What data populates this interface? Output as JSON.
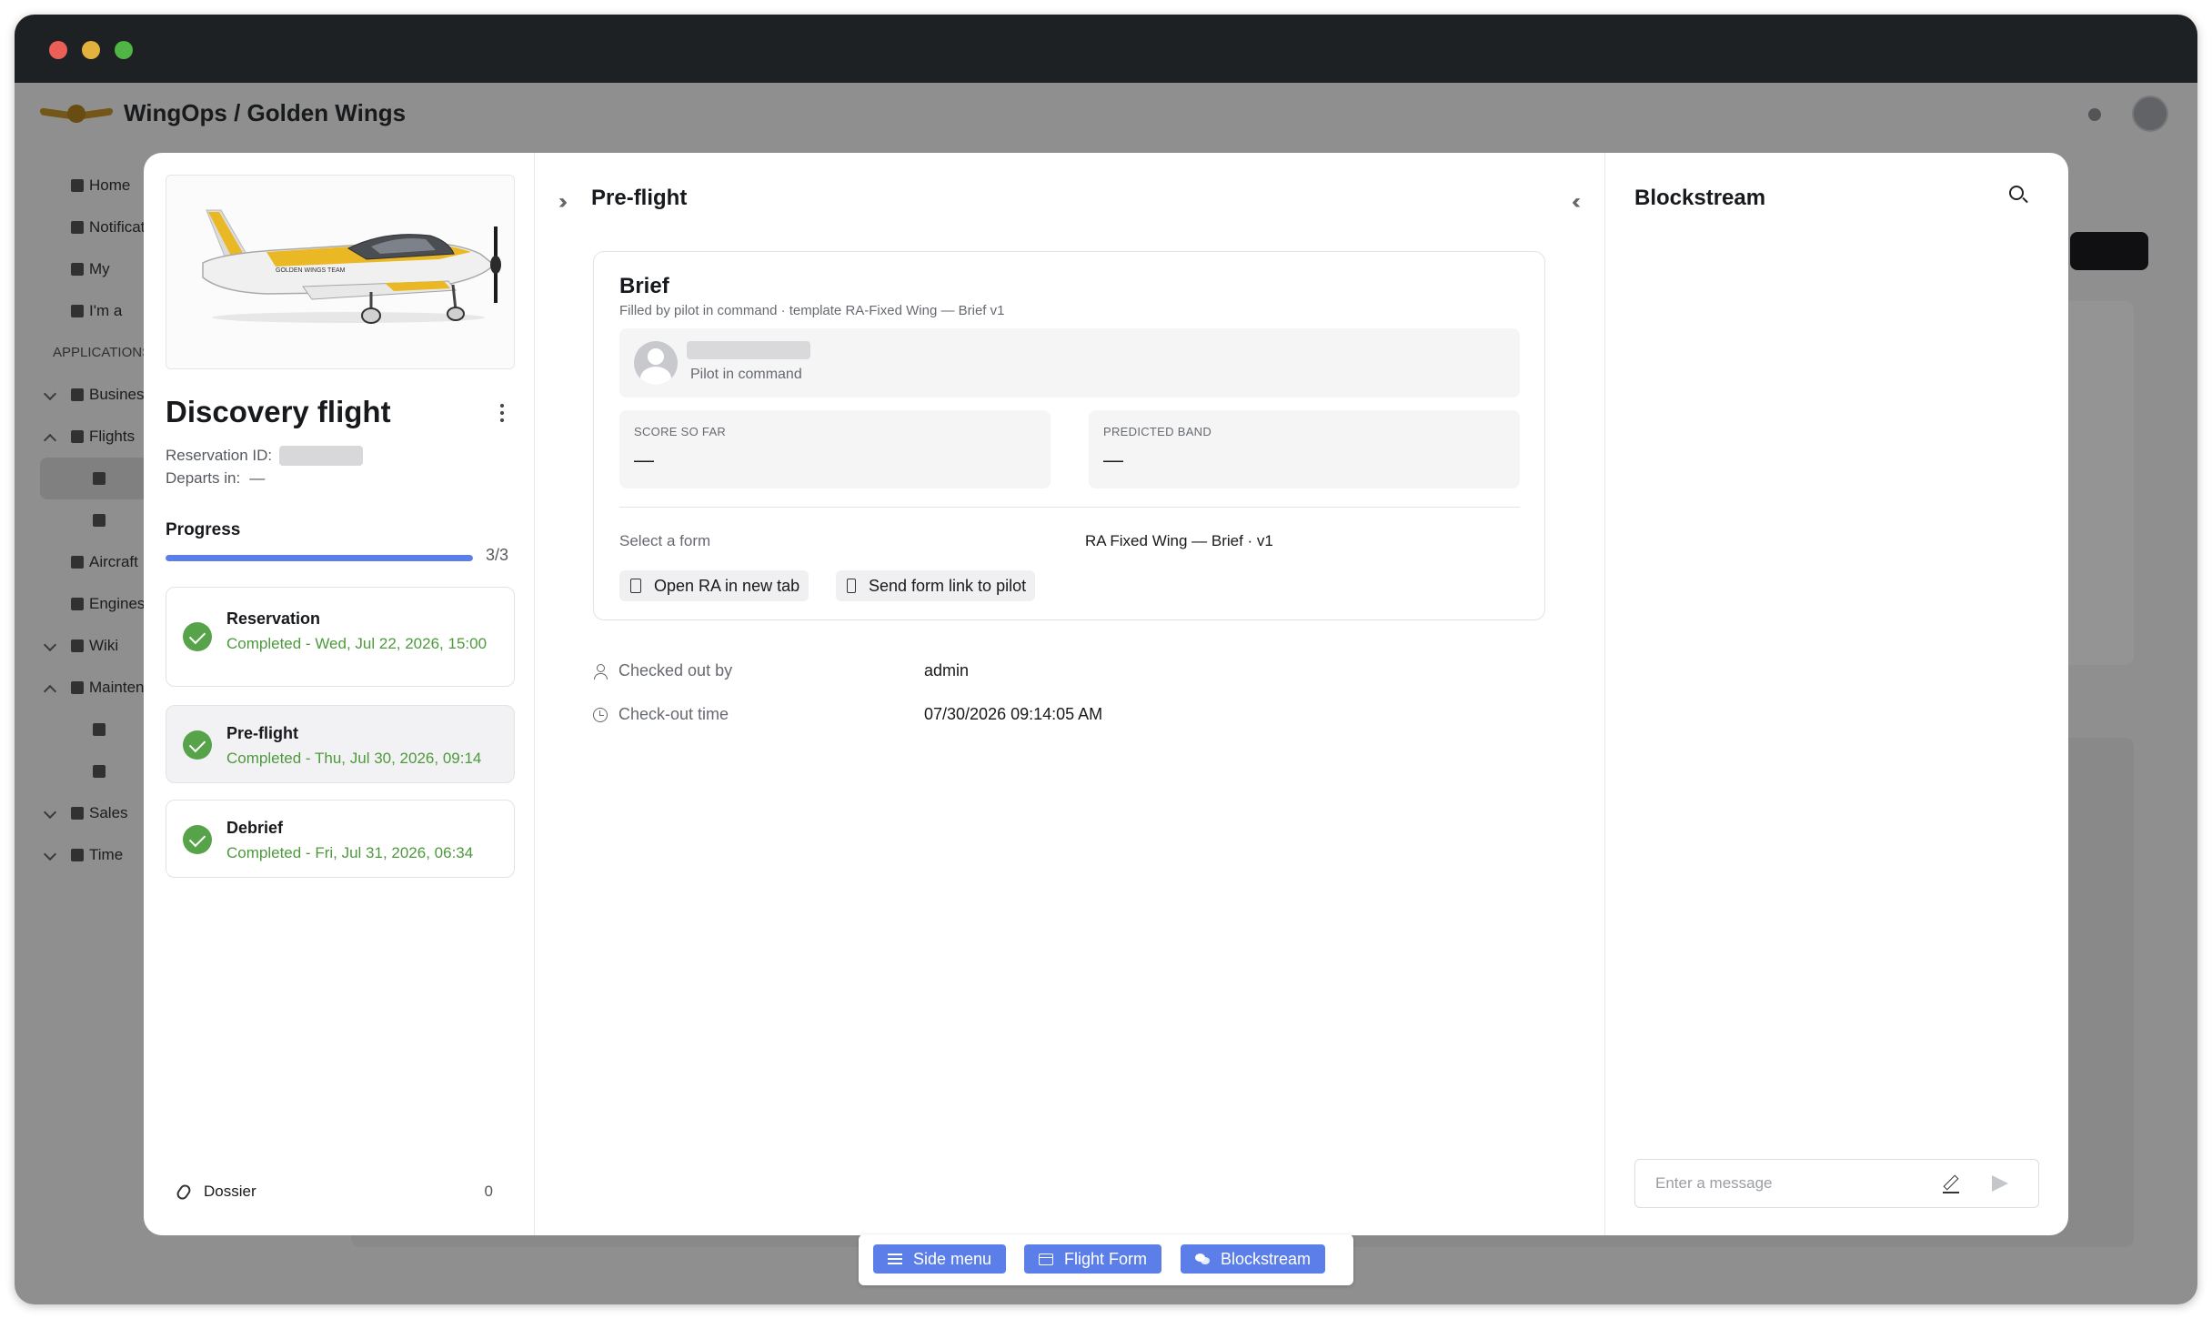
{
  "app": {
    "title": "WingOps / Golden Wings",
    "sidebar": [
      "Home",
      "Notifications",
      "My",
      "I'm a",
      "Applications",
      "Business",
      "Flights",
      "",
      "",
      "Aircraft",
      "Engines",
      "Wiki",
      "Maintenance",
      "",
      "",
      "Sales",
      "Time"
    ]
  },
  "flight": {
    "title": "Discovery flight",
    "reservation_label": "Reservation ID:",
    "departs_label": "Departs in:",
    "departs_value": "—",
    "progress_label": "Progress",
    "progress_count": "3/3",
    "progress_fraction": 1.0
  },
  "steps": [
    {
      "title": "Reservation",
      "status": "Completed - Wed, Jul 22, 2026, 15:00"
    },
    {
      "title": "Pre-flight",
      "status": "Completed - Thu, Jul 30, 2026, 09:14"
    },
    {
      "title": "Debrief",
      "status": "Completed - Fri, Jul 31, 2026, 06:34"
    }
  ],
  "dossier": {
    "label": "Dossier",
    "count": "0"
  },
  "preflight": {
    "title": "Pre-flight",
    "brief": {
      "title": "Brief",
      "subtitle": "Filled by pilot in command · template RA-Fixed Wing — Brief v1",
      "pilot_role": "Pilot in command",
      "score_label": "SCORE SO FAR",
      "score_value": "—",
      "band_label": "PREDICTED BAND",
      "band_value": "—",
      "select_label": "Select a form",
      "select_value": "RA Fixed Wing — Brief · v1",
      "open_button": "Open RA in new tab",
      "send_button": "Send form link to pilot"
    },
    "checked_out_label": "Checked out by",
    "checked_out_value": "admin",
    "checkout_time_label": "Check-out time",
    "checkout_time_value": "07/30/2026 09:14:05 AM"
  },
  "blockstream": {
    "title": "Blockstream",
    "message_placeholder": "Enter a message"
  },
  "bottom_bar": {
    "side_menu": "Side menu",
    "flight_form": "Flight Form",
    "blockstream": "Blockstream"
  },
  "colors": {
    "accent": "#5b7ee8",
    "success": "#57a34a",
    "success_text": "#4c9a3c",
    "titlebar": "#1e2124",
    "plane_yellow": "#e9b824"
  }
}
